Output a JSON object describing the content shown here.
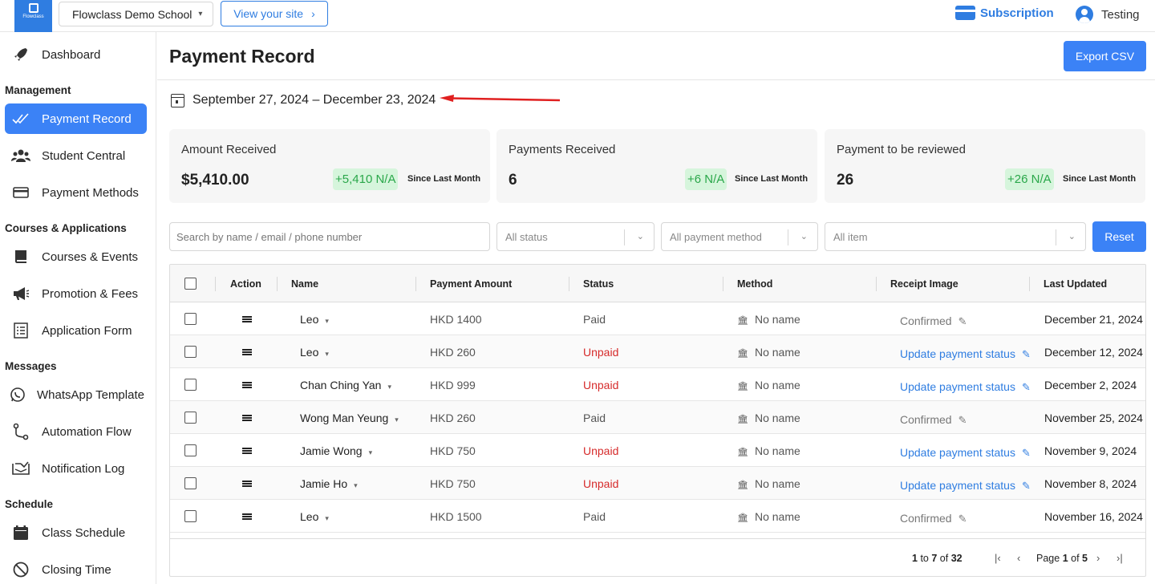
{
  "topbar": {
    "logo_text": "Flowclass",
    "school_name": "Flowclass Demo School",
    "view_site_label": "View your site",
    "subscription_label": "Subscription",
    "user_name": "Testing"
  },
  "sidebar": {
    "items_top": [
      {
        "label": "Dashboard",
        "icon": "rocket-icon"
      }
    ],
    "sections": [
      {
        "title": "Management",
        "items": [
          {
            "label": "Payment Record",
            "icon": "checks-icon",
            "active": true
          },
          {
            "label": "Student Central",
            "icon": "users-icon"
          },
          {
            "label": "Payment Methods",
            "icon": "card-icon"
          }
        ]
      },
      {
        "title": "Courses & Applications",
        "items": [
          {
            "label": "Courses & Events",
            "icon": "book-icon"
          },
          {
            "label": "Promotion & Fees",
            "icon": "megaphone-icon"
          },
          {
            "label": "Application Form",
            "icon": "form-icon"
          }
        ]
      },
      {
        "title": "Messages",
        "items": [
          {
            "label": "WhatsApp Template",
            "icon": "whatsapp-icon"
          },
          {
            "label": "Automation Flow",
            "icon": "flow-icon"
          },
          {
            "label": "Notification Log",
            "icon": "inbox-icon"
          }
        ]
      },
      {
        "title": "Schedule",
        "items": [
          {
            "label": "Class Schedule",
            "icon": "calendar-icon"
          },
          {
            "label": "Closing Time",
            "icon": "block-icon"
          }
        ]
      }
    ]
  },
  "main": {
    "title": "Payment Record",
    "export_label": "Export CSV",
    "date_range": "September 27, 2024 – December 23, 2024",
    "stats": [
      {
        "label": "Amount Received",
        "value": "$5,410.00",
        "change": "+5,410 N/A",
        "since": "Since Last Month"
      },
      {
        "label": "Payments Received",
        "value": "6",
        "change": "+6 N/A",
        "since": "Since Last Month"
      },
      {
        "label": "Payment to be reviewed",
        "value": "26",
        "change": "+26 N/A",
        "since": "Since Last Month"
      }
    ],
    "filters": {
      "search_placeholder": "Search by name / email / phone number",
      "status": "All status",
      "method": "All payment method",
      "item": "All item",
      "reset_label": "Reset"
    },
    "table": {
      "columns": [
        "Action",
        "Name",
        "Payment Amount",
        "Status",
        "Method",
        "Receipt Image",
        "Last Updated"
      ],
      "rows": [
        {
          "name": "Leo",
          "amount": "HKD 1400",
          "status": "Paid",
          "method": "No name",
          "receipt": "Confirmed",
          "updated": "December 21, 2024"
        },
        {
          "name": "Leo",
          "amount": "HKD 260",
          "status": "Unpaid",
          "method": "No name",
          "receipt": "Update payment status",
          "updated": "December 12, 2024"
        },
        {
          "name": "Chan Ching Yan",
          "amount": "HKD 999",
          "status": "Unpaid",
          "method": "No name",
          "receipt": "Update payment status",
          "updated": "December 2, 2024"
        },
        {
          "name": "Wong Man Yeung",
          "amount": "HKD 260",
          "status": "Paid",
          "method": "No name",
          "receipt": "Confirmed",
          "updated": "November 25, 2024"
        },
        {
          "name": "Jamie Wong",
          "amount": "HKD 750",
          "status": "Unpaid",
          "method": "No name",
          "receipt": "Update payment status",
          "updated": "November 9, 2024"
        },
        {
          "name": "Jamie Ho",
          "amount": "HKD 750",
          "status": "Unpaid",
          "method": "No name",
          "receipt": "Update payment status",
          "updated": "November 8, 2024"
        },
        {
          "name": "Leo",
          "amount": "HKD 1500",
          "status": "Paid",
          "method": "No name",
          "receipt": "Confirmed",
          "updated": "November 16, 2024"
        }
      ]
    },
    "pagination": {
      "from": "1",
      "to_word": "to",
      "to": "7",
      "of_word": "of",
      "total": "32",
      "page_word": "Page",
      "page": "1",
      "page_of_word": "of",
      "pages": "5"
    }
  },
  "colors": {
    "accent": "#3b82f6",
    "unpaid": "#d62b2b",
    "positive": "#2aa74a",
    "annotation_arrow": "#e02020"
  }
}
